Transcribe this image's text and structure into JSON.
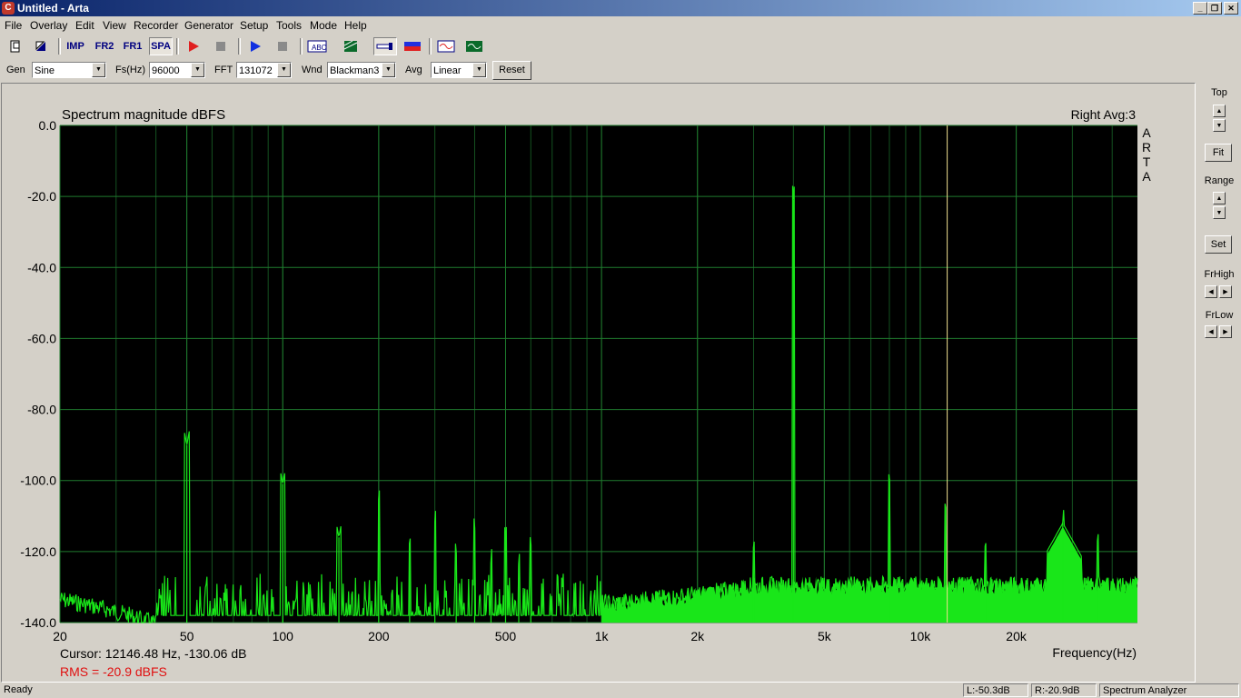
{
  "window": {
    "title": "Untitled - Arta"
  },
  "menu": [
    "File",
    "Overlay",
    "Edit",
    "View",
    "Recorder",
    "Generator",
    "Setup",
    "Tools",
    "Mode",
    "Help"
  ],
  "toolbar": {
    "imp": "IMP",
    "fr2": "FR2",
    "fr1": "FR1",
    "spa": "SPA",
    "icons": [
      "new-file-icon",
      "open-icon",
      "record-icon",
      "stop-icon",
      "play-icon",
      "stop-play-icon",
      "text-abc-icon",
      "grid-icon",
      "cursor-icon",
      "color-icon",
      "waveform-icon",
      "scope-icon"
    ]
  },
  "controls": {
    "gen_label": "Gen",
    "gen_value": "Sine",
    "fs_label": "Fs(Hz)",
    "fs_value": "96000",
    "fft_label": "FFT",
    "fft_value": "131072",
    "wnd_label": "Wnd",
    "wnd_value": "Blackman3",
    "avg_label": "Avg",
    "avg_value": "Linear",
    "reset_label": "Reset"
  },
  "side": {
    "top_label": "Top",
    "fit_label": "Fit",
    "range_label": "Range",
    "set_label": "Set",
    "frhigh_label": "FrHigh",
    "frlow_label": "FrLow"
  },
  "chart_data": {
    "type": "line",
    "title": "Spectrum magnitude dBFS",
    "top_right": "Right  Avg:3",
    "watermark": [
      "A",
      "R",
      "T",
      "A"
    ],
    "xlabel": "Frequency(Hz)",
    "x_scale": "log",
    "xlim": [
      20,
      48000
    ],
    "ylim": [
      -140,
      0
    ],
    "yticks": [
      0,
      -20,
      -40,
      -60,
      -80,
      -100,
      -120,
      -140
    ],
    "ytick_labels": [
      "0.0",
      "-20.0",
      "-40.0",
      "-60.0",
      "-80.0",
      "-100.0",
      "-120.0",
      "-140.0"
    ],
    "xticks": [
      20,
      50,
      100,
      200,
      500,
      1000,
      2000,
      5000,
      10000,
      20000
    ],
    "xtick_labels": [
      "20",
      "50",
      "100",
      "200",
      "500",
      "1k",
      "2k",
      "5k",
      "10k",
      "20k"
    ],
    "cursor_freq": 12146.48,
    "grid": true,
    "background": "#000000",
    "grid_color": "#1f7a2e",
    "trace_color": "#19e619",
    "noise_floor": -130,
    "peaks": [
      {
        "f": 50,
        "db": -90
      },
      {
        "f": 100,
        "db": -101
      },
      {
        "f": 150,
        "db": -116
      },
      {
        "f": 200,
        "db": -106
      },
      {
        "f": 250,
        "db": -119
      },
      {
        "f": 300,
        "db": -112
      },
      {
        "f": 350,
        "db": -121
      },
      {
        "f": 400,
        "db": -114
      },
      {
        "f": 450,
        "db": -123
      },
      {
        "f": 500,
        "db": -117
      },
      {
        "f": 550,
        "db": -124
      },
      {
        "f": 600,
        "db": -119
      },
      {
        "f": 3000,
        "db": -120
      },
      {
        "f": 4000,
        "db": -21
      },
      {
        "f": 8000,
        "db": -101
      },
      {
        "f": 12000,
        "db": -109
      },
      {
        "f": 16000,
        "db": -120
      },
      {
        "f": 28000,
        "db": -112
      },
      {
        "f": 36000,
        "db": -118
      }
    ]
  },
  "readouts": {
    "cursor": "Cursor: 12146.48 Hz, -130.06 dB",
    "rms": "RMS =  -20.9 dBFS"
  },
  "status": {
    "ready": "Ready",
    "left": "L:-50.3dB",
    "right": "R:-20.9dB",
    "mode": "Spectrum Analyzer"
  }
}
